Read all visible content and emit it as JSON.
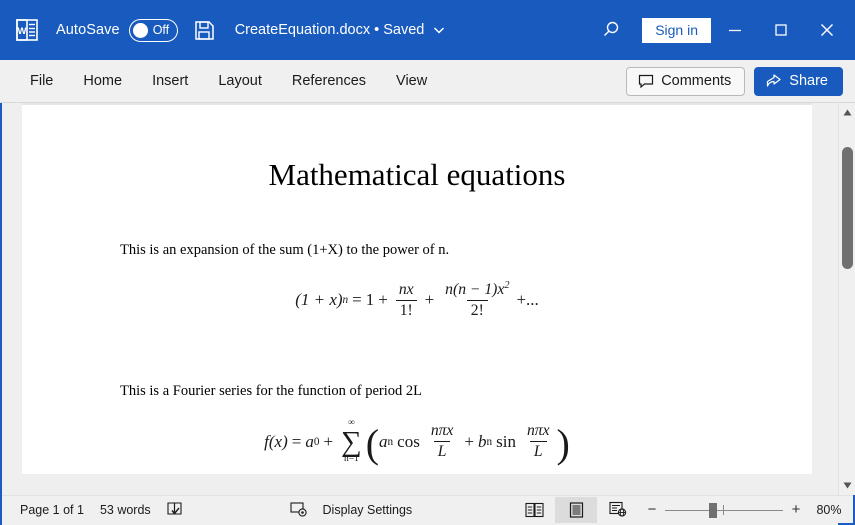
{
  "window": {
    "app_icon": "word-logo-icon",
    "accent_color": "#185abd",
    "titlebar": {
      "autosave_label": "AutoSave",
      "autosave_state": "Off",
      "save_icon": "save-floppy-icon",
      "document_title": "CreateEquation.docx • Saved",
      "title_dropdown_icon": "chevron-down-icon",
      "search_icon": "search-magnifier-icon",
      "signin_label": "Sign in",
      "minimize_icon": "minimize-icon",
      "maximize_icon": "maximize-icon",
      "close_icon": "close-icon"
    }
  },
  "ribbon": {
    "tabs": [
      {
        "label": "File"
      },
      {
        "label": "Home"
      },
      {
        "label": "Insert"
      },
      {
        "label": "Layout"
      },
      {
        "label": "References"
      },
      {
        "label": "View"
      }
    ],
    "comments_label": "Comments",
    "comments_icon": "comment-bubble-icon",
    "share_label": "Share",
    "share_icon": "share-arrow-icon"
  },
  "document": {
    "heading": "Mathematical equations",
    "paragraph_1": "This is an expansion of the sum (1+X) to the power of n.",
    "paragraph_2": "This is a Fourier series for the function of period 2L",
    "equation_1": {
      "plain": "(1 + x)^n = 1 + nx/1! + n(n − 1)x^2/2! + ...",
      "lhs_base": "(1 + x)",
      "lhs_exp": "n",
      "equals": "=",
      "term_one": "1",
      "plus": "+",
      "frac1_num_coef": "nx",
      "frac1_den": "1!",
      "frac2_num": "n(n − 1)x",
      "frac2_num_exp": "2",
      "frac2_den": "2!",
      "tail": "+..."
    },
    "equation_2": {
      "plain": "f(x) = a0 + Σ(n=1..∞) ( an cos(nπx/L) + bn sin(nπx/L) )",
      "fx": "f(x)",
      "equals": "=",
      "a_base": "a",
      "a_sub": "0",
      "plus": "+",
      "sigma_upper": "∞",
      "sigma_glyph": "∑",
      "sigma_lower": "n=1",
      "open_paren": "(",
      "an_base": "a",
      "an_sub": "n",
      "cos": "cos",
      "num_cos": "nπx",
      "den_cos": "L",
      "mid_plus": "+",
      "bn_base": "b",
      "bn_sub": "n",
      "sin": "sin",
      "num_sin": "nπx",
      "den_sin": "L",
      "close_paren": ")"
    }
  },
  "scrollbars": {
    "v_up_icon": "scroll-up-arrow-icon",
    "v_down_icon": "scroll-down-arrow-icon",
    "h_left_icon": "scroll-left-arrow-icon",
    "h_right_icon": "scroll-right-arrow-icon"
  },
  "statusbar": {
    "page_label": "Page 1 of 1",
    "word_count": "53 words",
    "proofing_icon": "proofing-check-icon",
    "display_settings_label": "Display Settings",
    "display_settings_icon": "display-settings-icon",
    "view_read_icon": "read-mode-icon",
    "view_print_icon": "print-layout-icon",
    "view_web_icon": "web-layout-icon",
    "zoom_out": "−",
    "zoom_in": "+",
    "zoom_level": "80%"
  }
}
